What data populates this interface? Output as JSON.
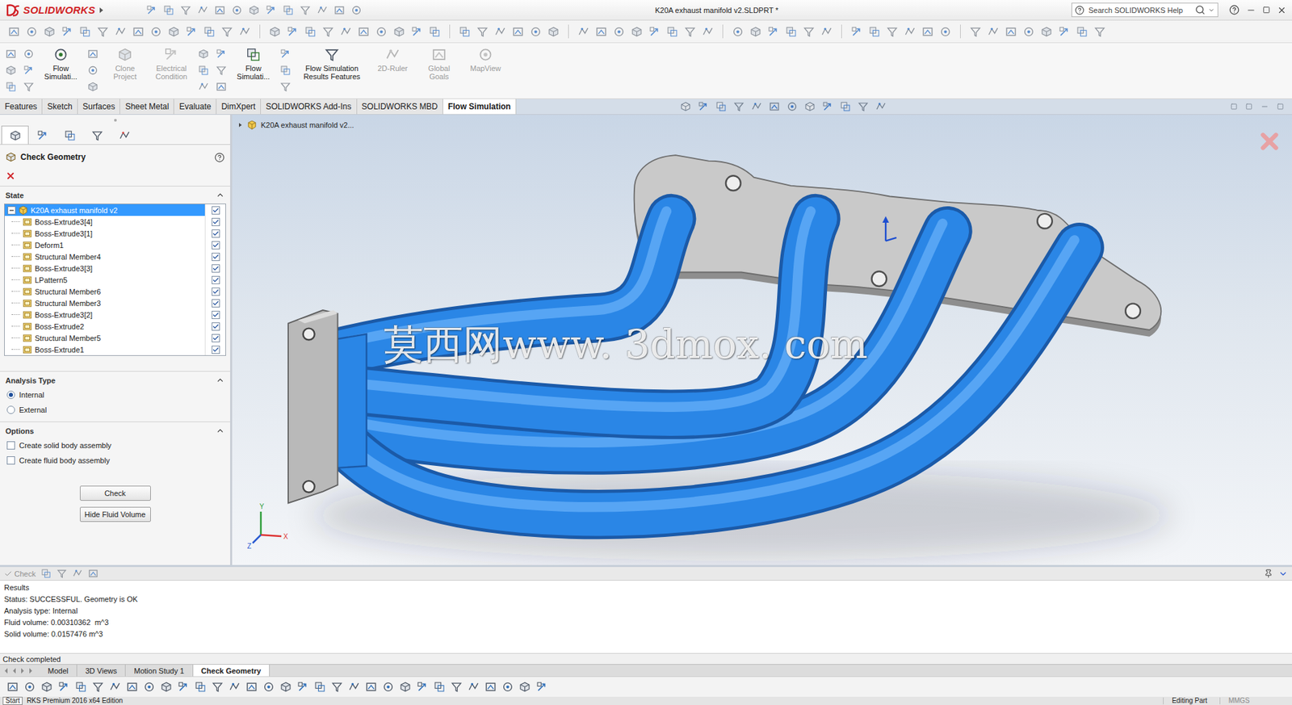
{
  "window": {
    "title": "K20A exhaust manifold v2.SLDPRT *",
    "logo": "SOLIDWORKS",
    "search": {
      "placeholder": "Search SOLIDWORKS Help"
    }
  },
  "ribbon": {
    "buttons": [
      {
        "label": "Flow Simulati...",
        "disabled": false
      },
      {
        "label": "Clone Project",
        "disabled": true
      },
      {
        "label": "Electrical Condition",
        "disabled": true
      },
      {
        "label": "Flow Simulati...",
        "disabled": false
      },
      {
        "label": "Flow Simulation Results Features",
        "disabled": false
      },
      {
        "label": "2D-Ruler",
        "disabled": true
      },
      {
        "label": "Global Goals",
        "disabled": true
      },
      {
        "label": "MapView",
        "disabled": true
      }
    ]
  },
  "tabs": [
    {
      "label": "Features",
      "selected": false
    },
    {
      "label": "Sketch",
      "selected": false
    },
    {
      "label": "Surfaces",
      "selected": false
    },
    {
      "label": "Sheet Metal",
      "selected": false
    },
    {
      "label": "Evaluate",
      "selected": false
    },
    {
      "label": "DimXpert",
      "selected": false
    },
    {
      "label": "SOLIDWORKS Add-Ins",
      "selected": false
    },
    {
      "label": "SOLIDWORKS MBD",
      "selected": false
    },
    {
      "label": "Flow Simulation",
      "selected": true
    }
  ],
  "property_manager": {
    "title": "Check Geometry",
    "state": {
      "title": "State",
      "expanded": true,
      "root": {
        "label": "K20A exhaust manifold v2",
        "selected": true,
        "expanded": true,
        "checked": true
      },
      "items": [
        {
          "label": "Boss-Extrude3[4]",
          "checked": true
        },
        {
          "label": "Boss-Extrude3[1]",
          "checked": true
        },
        {
          "label": "Deform1",
          "checked": true
        },
        {
          "label": "Structural Member4",
          "checked": true
        },
        {
          "label": "Boss-Extrude3[3]",
          "checked": true
        },
        {
          "label": "LPattern5",
          "checked": true
        },
        {
          "label": "Structural Member6",
          "checked": true
        },
        {
          "label": "Structural Member3",
          "checked": true
        },
        {
          "label": "Boss-Extrude3[2]",
          "checked": true
        },
        {
          "label": "Boss-Extrude2",
          "checked": true
        },
        {
          "label": "Structural Member5",
          "checked": true
        },
        {
          "label": "Boss-Extrude1",
          "checked": true
        }
      ]
    },
    "analysis_type": {
      "title": "Analysis Type",
      "expanded": true,
      "options": [
        {
          "label": "Internal",
          "selected": true
        },
        {
          "label": "External",
          "selected": false
        }
      ]
    },
    "options": {
      "title": "Options",
      "expanded": true,
      "items": [
        {
          "label": "Create solid body assembly",
          "checked": false
        },
        {
          "label": "Create fluid body assembly",
          "checked": false
        }
      ]
    },
    "buttons": [
      "Check",
      "Hide Fluid Volume"
    ]
  },
  "viewport": {
    "breadcrumb": "K20A exhaust manifold v2...",
    "watermark": "莫西网www. 3dmox. com",
    "triad": [
      "X",
      "Y",
      "Z"
    ]
  },
  "results": {
    "toolbar": {
      "label": "Check",
      "disabled": true
    },
    "heading": "Results",
    "lines": [
      "Status: SUCCESSFUL. Geometry is OK",
      "Analysis type: Internal",
      "Fluid volume: 0.00310362  m^3",
      "Solid volume: 0.0157476 m^3"
    ],
    "status": "Check completed"
  },
  "bottom_tabs": [
    {
      "label": "Model",
      "selected": false
    },
    {
      "label": "3D Views",
      "selected": false
    },
    {
      "label": "Motion Study 1",
      "selected": false
    },
    {
      "label": "Check Geometry",
      "selected": true
    }
  ],
  "status_bar": {
    "start": "Start",
    "edition": "RKS Premium 2016 x64 Edition",
    "mode": "Editing Part",
    "units": "MMGS"
  }
}
